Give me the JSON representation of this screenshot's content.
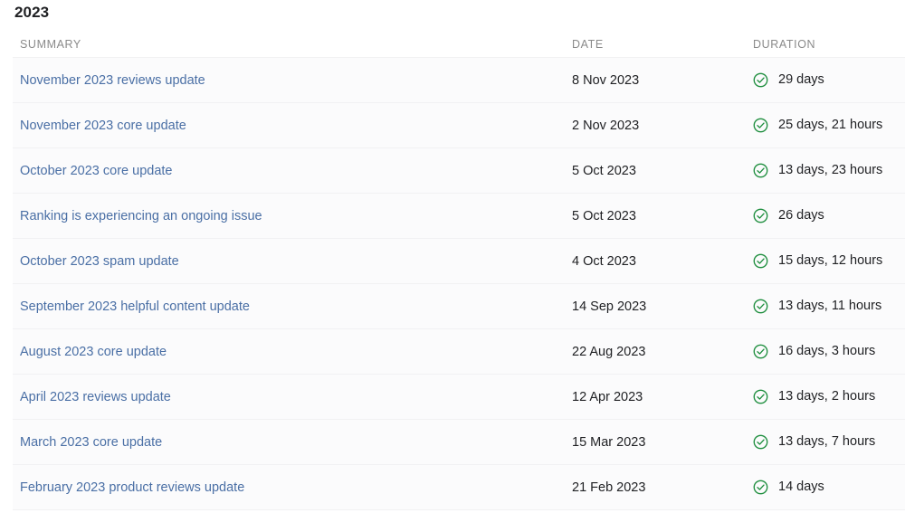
{
  "page": {
    "year_heading": "2023"
  },
  "table": {
    "columns": [
      {
        "key": "summary",
        "label": "SUMMARY"
      },
      {
        "key": "date",
        "label": "DATE"
      },
      {
        "key": "duration",
        "label": "DURATION"
      }
    ],
    "status_icon": "check-circle-icon",
    "status_icon_color": "#1e8e3e",
    "link_color": "#4a6fa5",
    "rows": [
      {
        "summary": "November 2023 reviews update",
        "date": "8 Nov 2023",
        "duration": "29 days",
        "status": "completed"
      },
      {
        "summary": "November 2023 core update",
        "date": "2 Nov 2023",
        "duration": "25 days, 21 hours",
        "status": "completed"
      },
      {
        "summary": "October 2023 core update",
        "date": "5 Oct 2023",
        "duration": "13 days, 23 hours",
        "status": "completed"
      },
      {
        "summary": "Ranking is experiencing an ongoing issue",
        "date": "5 Oct 2023",
        "duration": "26 days",
        "status": "completed"
      },
      {
        "summary": "October 2023 spam update",
        "date": "4 Oct 2023",
        "duration": "15 days, 12 hours",
        "status": "completed"
      },
      {
        "summary": "September 2023 helpful content update",
        "date": "14 Sep 2023",
        "duration": "13 days, 11 hours",
        "status": "completed"
      },
      {
        "summary": "August 2023 core update",
        "date": "22 Aug 2023",
        "duration": "16 days, 3 hours",
        "status": "completed"
      },
      {
        "summary": "April 2023 reviews update",
        "date": "12 Apr 2023",
        "duration": "13 days, 2 hours",
        "status": "completed"
      },
      {
        "summary": "March 2023 core update",
        "date": "15 Mar 2023",
        "duration": "13 days, 7 hours",
        "status": "completed"
      },
      {
        "summary": "February 2023 product reviews update",
        "date": "21 Feb 2023",
        "duration": "14 days",
        "status": "completed"
      }
    ]
  }
}
